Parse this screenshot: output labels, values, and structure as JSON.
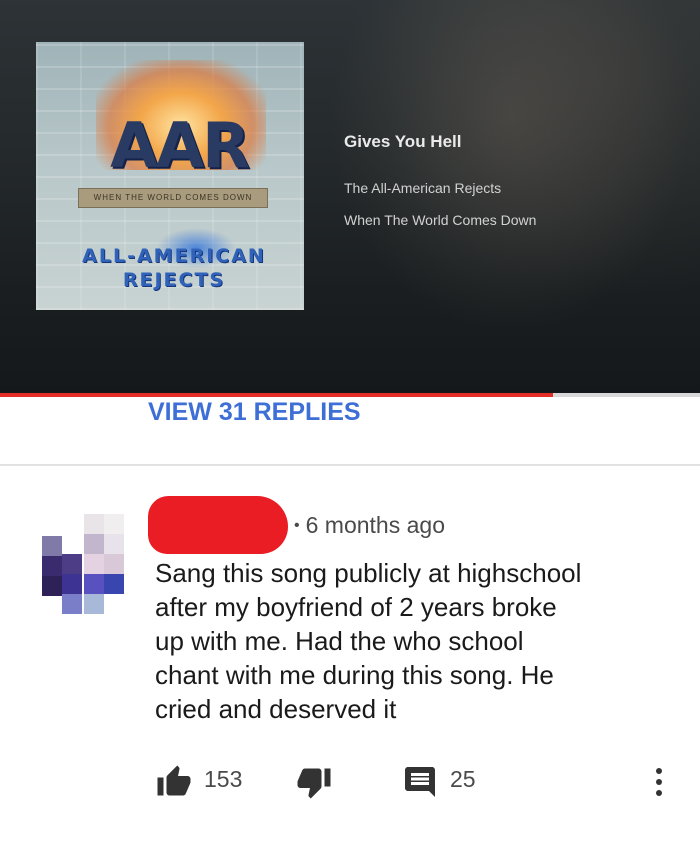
{
  "player": {
    "track_title": "Gives You Hell",
    "artist": "The All-American Rejects",
    "album": "When The World Comes Down",
    "progress": 0.79,
    "album_art": {
      "logo": "AAR",
      "banner": "WHEN THE WORLD COMES DOWN",
      "band_line1": "ALL-AMERICAN",
      "band_line2": "REJECTS"
    },
    "colors": {
      "progress_fill": "#e52d27",
      "progress_track": "#d7d7d7"
    }
  },
  "replies": {
    "label": "VIEW 31 REPLIES",
    "color": "#3e6fd6"
  },
  "comment": {
    "author": "",
    "time": "6 months ago",
    "text_lines": [
      "Sang this song publicly at highschool",
      "after my boyfriend of 2 years broke",
      "up with me. Had the who school",
      "chant with me during this song. He",
      "cried and deserved it"
    ],
    "likes": "153",
    "replies_count": "25",
    "icons": {
      "like": "thumbs-up-icon",
      "dislike": "thumbs-down-icon",
      "reply": "comment-icon",
      "more": "more-vert-icon"
    }
  }
}
